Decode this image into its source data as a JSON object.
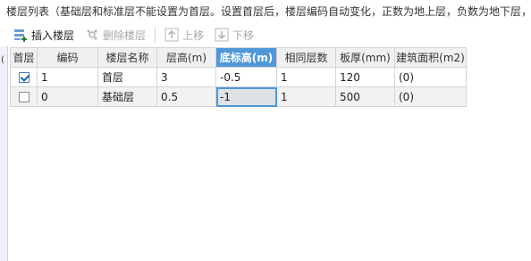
{
  "info_text": "楼层列表（基础层和标准层不能设置为首层。设置首层后，楼层编码自动变化，正数为地上层，负数为地下层，",
  "toolbar": {
    "insert_label": "插入楼层",
    "delete_label": "删除楼层",
    "up_label": "上移",
    "down_label": "下移"
  },
  "strip_char": "(",
  "table": {
    "headers": [
      "首层",
      "编码",
      "楼层名称",
      "层高(m)",
      "底标高(m)",
      "相同层数",
      "板厚(mm)",
      "建筑面积(m2)"
    ],
    "active_column": "底标高(m)",
    "rows": [
      {
        "first_floor": true,
        "code": "1",
        "name": "首层",
        "height": "3",
        "bottom_elev": "-0.5",
        "same_count": "1",
        "slab": "120",
        "area": "(0)"
      },
      {
        "first_floor": false,
        "code": "0",
        "name": "基础层",
        "height": "0.5",
        "bottom_elev": "-1",
        "same_count": "1",
        "slab": "500",
        "area": "(0)"
      }
    ]
  },
  "colors": {
    "header_active": "#4f98d8",
    "selection": "#4f98d8"
  }
}
